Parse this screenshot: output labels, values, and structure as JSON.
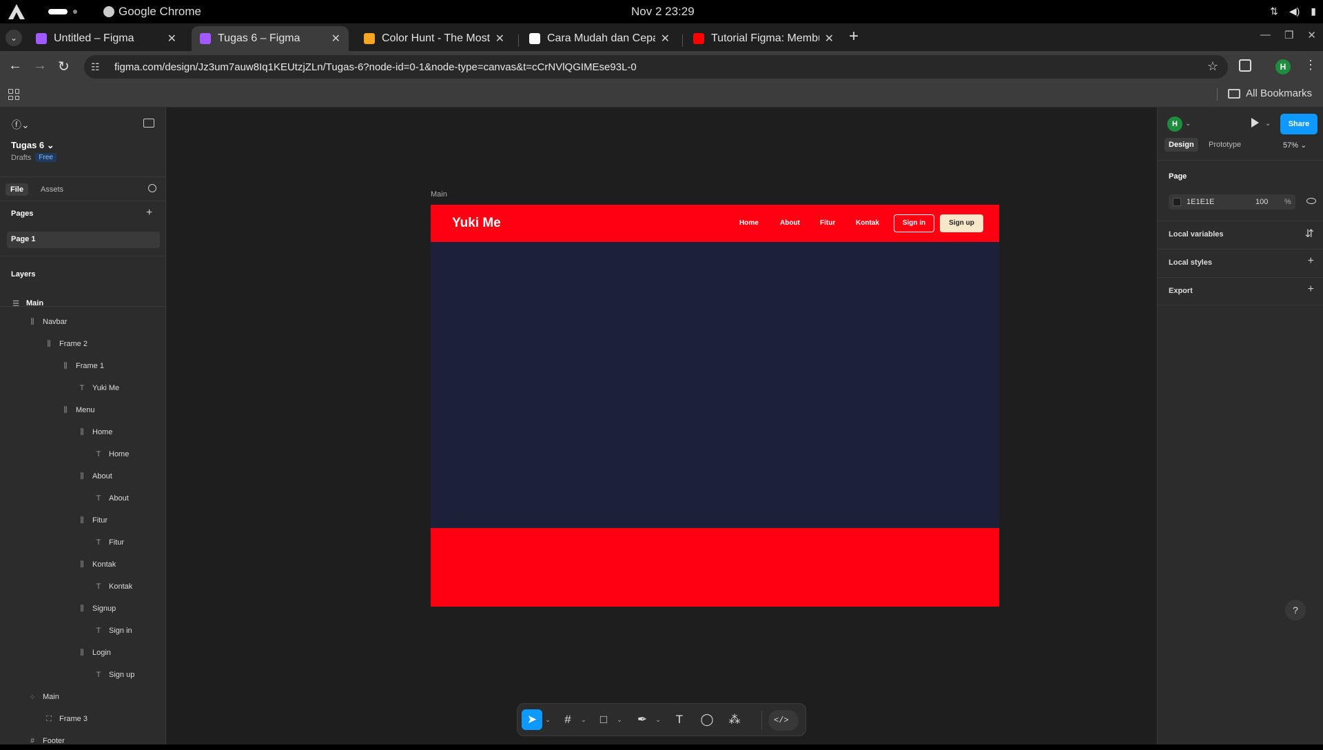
{
  "os": {
    "app_name": "Google Chrome",
    "clock": "Nov 2  23:29"
  },
  "browser": {
    "tabs": [
      {
        "title": "Untitled – Figma",
        "favicon_color": "#a259ff"
      },
      {
        "title": "Tugas 6 – Figma",
        "favicon_color": "#a259ff"
      },
      {
        "title": "Color Hunt - The Most Po",
        "favicon_color": "#f5a623"
      },
      {
        "title": "Cara Mudah dan Cepat M",
        "favicon_color": "#ffffff"
      },
      {
        "title": "Tutorial Figma: Membuat",
        "favicon_color": "#ff0000"
      }
    ],
    "active_tab_index": 1,
    "url": "figma.com/design/Jz3um7auw8Iq1KEUtzjZLn/Tugas-6?node-id=0-1&node-type=canvas&t=cCrNVlQGIMEse93L-0",
    "profile_initial": "H",
    "bookmarks_label": "All Bookmarks"
  },
  "figma": {
    "file_name": "Tugas 6",
    "location": "Drafts",
    "plan_badge": "Free",
    "left_tabs": {
      "file": "File",
      "assets": "Assets"
    },
    "pages_heading": "Pages",
    "pages": [
      "Page 1"
    ],
    "layers_heading": "Layers",
    "layers": [
      {
        "name": "Main",
        "icon": "section-icon"
      },
      {
        "name": "Navbar",
        "icon": "auto-layout-icon"
      },
      {
        "name": "Frame 2",
        "icon": "auto-layout-icon"
      },
      {
        "name": "Frame 1",
        "icon": "auto-layout-icon"
      },
      {
        "name": "Yuki Me",
        "icon": "text-icon"
      },
      {
        "name": "Menu",
        "icon": "auto-layout-icon"
      },
      {
        "name": "Home",
        "icon": "auto-layout-icon"
      },
      {
        "name": "Home",
        "icon": "text-icon"
      },
      {
        "name": "About",
        "icon": "auto-layout-icon"
      },
      {
        "name": "About",
        "icon": "text-icon"
      },
      {
        "name": "Fitur",
        "icon": "auto-layout-icon"
      },
      {
        "name": "Fitur",
        "icon": "text-icon"
      },
      {
        "name": "Kontak",
        "icon": "auto-layout-icon"
      },
      {
        "name": "Kontak",
        "icon": "text-icon"
      },
      {
        "name": "Signup",
        "icon": "auto-layout-icon"
      },
      {
        "name": "Sign in",
        "icon": "text-icon"
      },
      {
        "name": "Login",
        "icon": "auto-layout-icon"
      },
      {
        "name": "Sign up",
        "icon": "text-icon"
      },
      {
        "name": "Main",
        "icon": "grid-icon"
      },
      {
        "name": "Frame 3",
        "icon": "frame-icon"
      },
      {
        "name": "Footer",
        "icon": "hash-icon"
      }
    ],
    "right": {
      "user_initial": "H",
      "share_label": "Share",
      "tabs": {
        "design": "Design",
        "prototype": "Prototype"
      },
      "zoom": "57%",
      "page_heading": "Page",
      "page_fill_hex": "1E1E1E",
      "page_fill_opacity": "100",
      "percent_sign": "%",
      "local_variables": "Local variables",
      "local_styles": "Local styles",
      "export": "Export"
    },
    "help": "?"
  },
  "canvas": {
    "frame_label": "Main",
    "brand": "Yuki Me",
    "menu": [
      "Home",
      "About",
      "Fitur",
      "Kontak"
    ],
    "sign_in": "Sign in",
    "sign_up": "Sign up",
    "colors": {
      "nav": "#ff0013",
      "body": "#1c2038",
      "footer": "#ff0013",
      "signup_bg": "#f5e7c8"
    }
  }
}
